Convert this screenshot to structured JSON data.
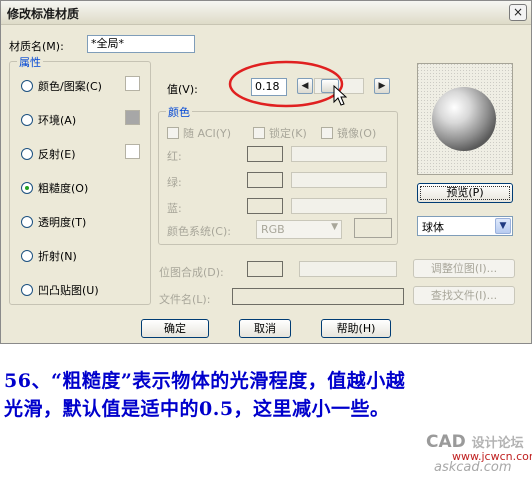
{
  "window": {
    "title": "修改标准材质",
    "close_glyph": "×"
  },
  "material_name": {
    "label": "材质名(M):",
    "value": "*全局*"
  },
  "attributes": {
    "title": "属性",
    "items": [
      {
        "label": "颜色/图案(C)",
        "selected": false
      },
      {
        "label": "环境(A)",
        "selected": false
      },
      {
        "label": "反射(E)",
        "selected": false
      },
      {
        "label": "粗糙度(O)",
        "selected": true
      },
      {
        "label": "透明度(T)",
        "selected": false
      },
      {
        "label": "折射(N)",
        "selected": false
      },
      {
        "label": "凹凸贴图(U)",
        "selected": false
      }
    ]
  },
  "value": {
    "label": "值(V):",
    "input": "0.18",
    "prev_glyph": "◀",
    "next_glyph": "▶",
    "level": 0.18
  },
  "color": {
    "title": "颜色",
    "by_aci": "随 ACI(Y)",
    "lock": "锁定(K)",
    "mirror": "镜像(O)",
    "red": "红:",
    "green": "绿:",
    "blue": "蓝:",
    "system_label": "颜色系统(C):",
    "system_value": "RGB"
  },
  "bitmap": {
    "blend_label": "位图合成(D):",
    "file_label": "文件名(L):",
    "adjust_button": "调整位图(I)...",
    "find_button": "查找文件(I)..."
  },
  "preview": {
    "button": "预览(P)",
    "shape": "球体"
  },
  "buttons": {
    "ok": "确定",
    "cancel": "取消",
    "help": "帮助(H)"
  },
  "caption": {
    "line1": "56、“粗糙度”表示物体的光滑程度，值越小越",
    "line2": "光滑，默认值是适中的0.5，这里减小一些。"
  },
  "watermark": {
    "logo": "CAD",
    "cn": "设计论坛",
    "url1": "www.jcwcn.com",
    "url2": "askcad.com"
  },
  "colors": {
    "highlight_ellipse": "#e02020",
    "caption": "#0000cc",
    "group_title": "#0046d5"
  }
}
